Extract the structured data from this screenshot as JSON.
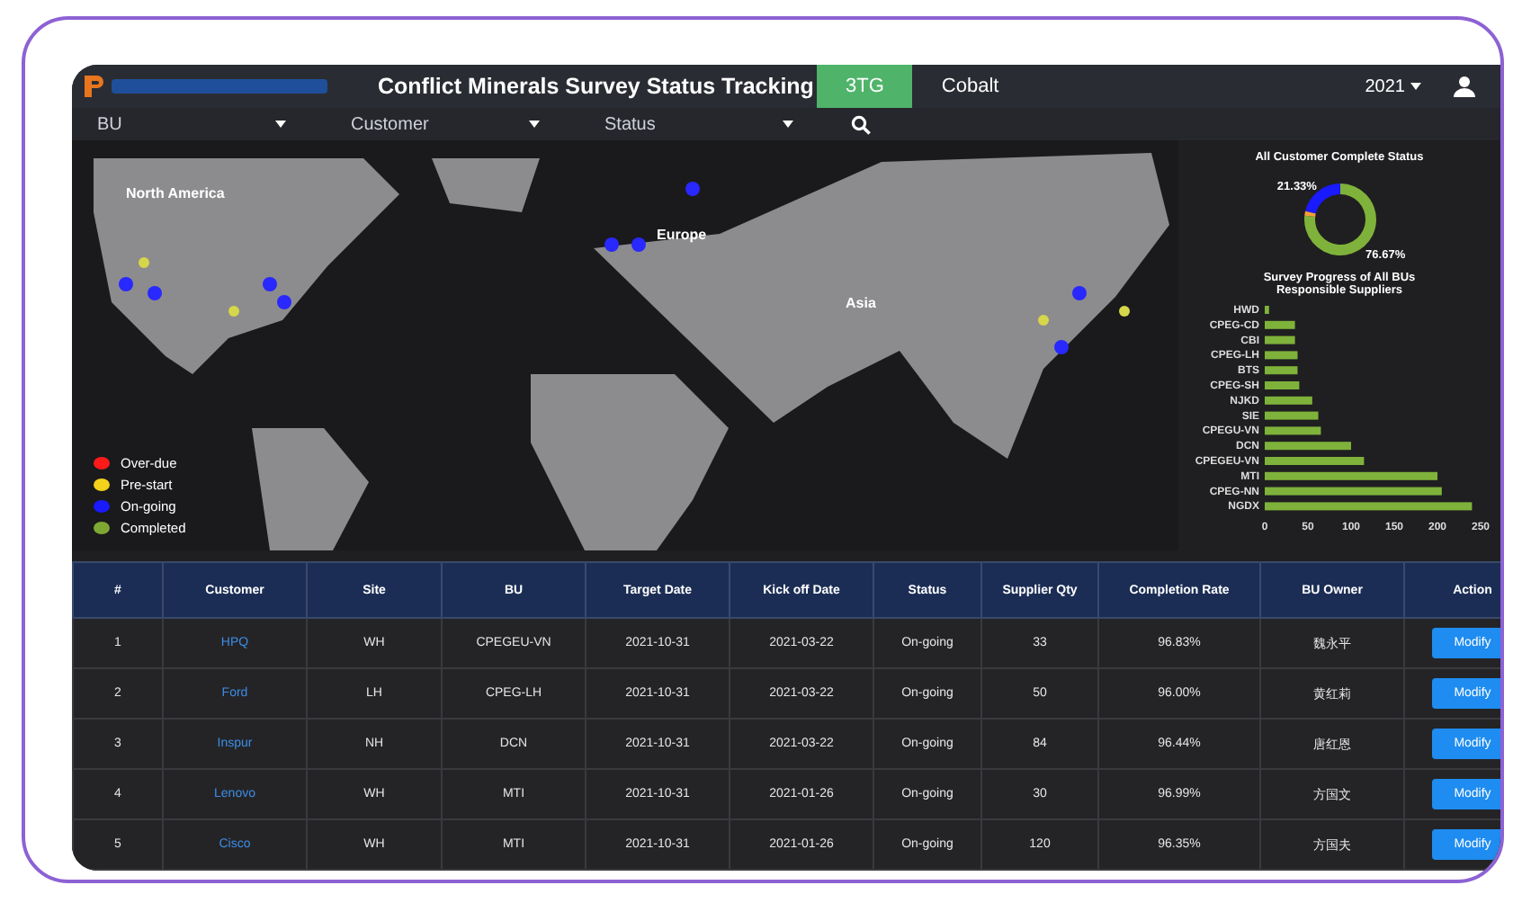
{
  "header": {
    "title": "Conflict Minerals Survey Status Tracking",
    "tabs": [
      {
        "label": "3TG",
        "selected": true
      },
      {
        "label": "Cobalt",
        "selected": false
      }
    ],
    "year": "2021"
  },
  "filters": [
    {
      "label": "BU"
    },
    {
      "label": "Customer"
    },
    {
      "label": "Status"
    }
  ],
  "map": {
    "regions": [
      "North America",
      "Europe",
      "Asia"
    ],
    "legend": [
      {
        "label": "Over-due",
        "color": "#ff1a1a"
      },
      {
        "label": "Pre-start",
        "color": "#f2d21b"
      },
      {
        "label": "On-going",
        "color": "#1a1aff"
      },
      {
        "label": "Completed",
        "color": "#7fa832"
      }
    ]
  },
  "status_chart": {
    "title": "All Customer Complete Status",
    "chart_data": {
      "type": "donut",
      "values": [
        21.33,
        76.67,
        2
      ],
      "colors": [
        "#1a1aff",
        "#7fb23a",
        "#f2a03a"
      ],
      "value_labels": [
        "21.33%",
        "76.67%",
        null
      ]
    }
  },
  "progress_chart": {
    "title": "Survey Progress of All BUs Responsible Suppliers",
    "chart_data": {
      "type": "bar",
      "orientation": "horizontal",
      "categories": [
        "HWD",
        "CPEG-CD",
        "CBI",
        "CPEG-LH",
        "BTS",
        "CPEG-SH",
        "NJKD",
        "SIE",
        "CPEGU-VN",
        "DCN",
        "CPEGEU-VN",
        "MTI",
        "CPEG-NN",
        "NGDX"
      ],
      "series": [
        {
          "color": "#7fb23a",
          "values": [
            5,
            35,
            35,
            38,
            38,
            40,
            55,
            62,
            65,
            100,
            115,
            200,
            205,
            240
          ]
        }
      ],
      "xlim": [
        0,
        250
      ],
      "xticks": [
        0,
        50,
        100,
        150,
        200,
        250
      ]
    }
  },
  "table": {
    "columns": [
      "#",
      "Customer",
      "Site",
      "BU",
      "Target Date",
      "Kick off Date",
      "Status",
      "Supplier Qty",
      "Completion Rate",
      "BU Owner",
      "Action"
    ],
    "rows": [
      {
        "cells": [
          "1",
          "HPQ",
          "WH",
          "CPEGEU-VN",
          "2021-10-31",
          "2021-03-22",
          "On-going",
          "33",
          "96.83%",
          "魏永平"
        ],
        "action": "Modify"
      },
      {
        "cells": [
          "2",
          "Ford",
          "LH",
          "CPEG-LH",
          "2021-10-31",
          "2021-03-22",
          "On-going",
          "50",
          "96.00%",
          "黄红莉"
        ],
        "action": "Modify"
      },
      {
        "cells": [
          "3",
          "Inspur",
          "NH",
          "DCN",
          "2021-10-31",
          "2021-03-22",
          "On-going",
          "84",
          "96.44%",
          "唐红恩"
        ],
        "action": "Modify"
      },
      {
        "cells": [
          "4",
          "Lenovo",
          "WH",
          "MTI",
          "2021-10-31",
          "2021-01-26",
          "On-going",
          "30",
          "96.99%",
          "方国文"
        ],
        "action": "Modify"
      },
      {
        "cells": [
          "5",
          "Cisco",
          "WH",
          "MTI",
          "2021-10-31",
          "2021-01-26",
          "On-going",
          "120",
          "96.35%",
          "方国夫"
        ],
        "action": "Modify"
      }
    ]
  }
}
